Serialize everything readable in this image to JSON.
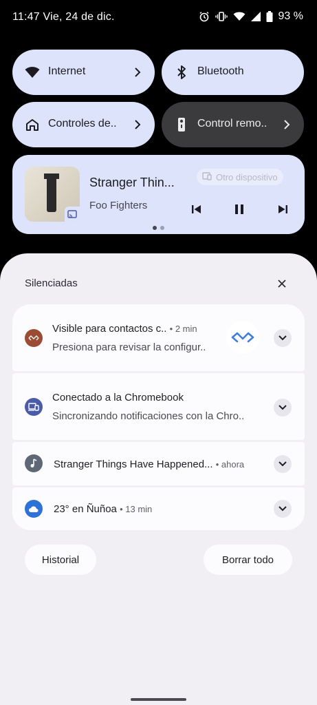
{
  "status": {
    "time_date": "11:47 Vie, 24 de dic.",
    "battery": "93 %"
  },
  "tiles": [
    {
      "label": "Internet",
      "icon": "wifi-icon"
    },
    {
      "label": "Bluetooth",
      "icon": "bluetooth-icon"
    },
    {
      "label": "Controles de..",
      "icon": "home-icon"
    },
    {
      "label": "Control remo..",
      "icon": "remote-icon"
    }
  ],
  "media": {
    "title": "Stranger Thin...",
    "artist": "Foo Fighters",
    "device": "Otro dispositivo"
  },
  "shade": {
    "section_label": "Silenciadas"
  },
  "notifications": [
    {
      "app_icon": "nearby-share-icon",
      "title": "Visible para contactos c..",
      "meta": "• 2 min",
      "text": "Presiona para revisar la configur..",
      "color": "#9a4d32"
    },
    {
      "app_icon": "devices-icon",
      "title": "Conectado a la Chromebook",
      "meta": "",
      "text": "Sincronizando notificaciones con la Chro..",
      "color": "#4a5ba8"
    },
    {
      "app_icon": "music-note-icon",
      "title": "Stranger Things Have Happened...",
      "meta": "• ahora",
      "text": "",
      "color": "#5f6877"
    },
    {
      "app_icon": "cloud-icon",
      "title": "23° en Ñuñoa",
      "meta": "• 13 min",
      "text": "",
      "color": "#2f72d6"
    }
  ],
  "actions": {
    "history": "Historial",
    "clear_all": "Borrar todo"
  },
  "colors": {
    "tile_light": "#dde3fa",
    "tile_dark": "#3b3b3e",
    "shade_bg": "#f1eff3",
    "card_bg": "#fcfbfe"
  }
}
